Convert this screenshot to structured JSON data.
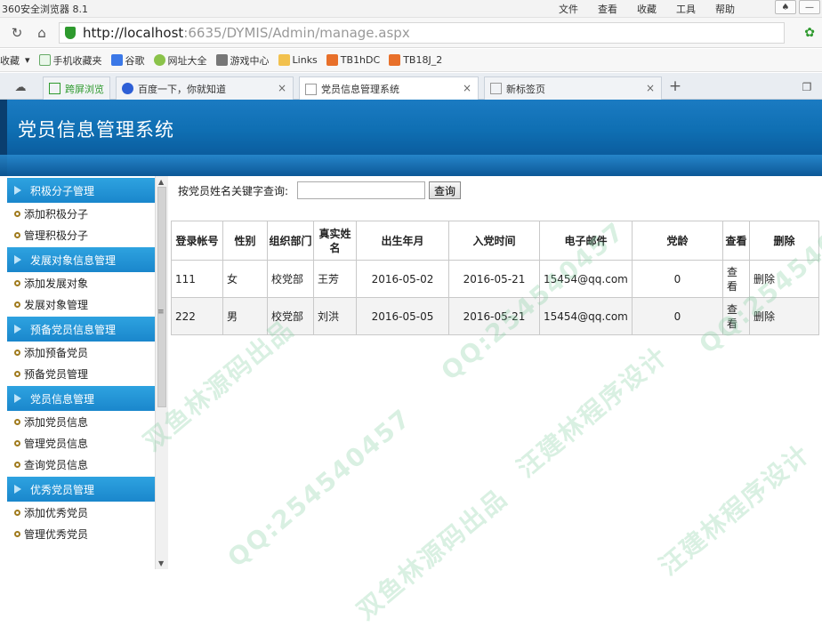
{
  "browser": {
    "title": "360安全浏览器 8.1",
    "menu": [
      "文件",
      "查看",
      "收藏",
      "工具",
      "帮助"
    ],
    "url_host": "http://localhost",
    "url_path": ":6635/DYMIS/Admin/manage.aspx",
    "favorites_label": "收藏",
    "favorites": [
      "手机收藏夹",
      "谷歌",
      "网址大全",
      "游戏中心",
      "Links",
      "TB1hDC",
      "TB18J_2"
    ],
    "tabs": [
      "跨屏浏览",
      "百度一下，你就知道",
      "党员信息管理系统",
      "新标签页"
    ]
  },
  "app": {
    "title": "党员信息管理系统"
  },
  "sidebar": {
    "sections": [
      {
        "title": "积极分子管理",
        "items": [
          "添加积极分子",
          "管理积极分子"
        ]
      },
      {
        "title": "发展对象信息管理",
        "items": [
          "添加发展对象",
          "发展对象管理"
        ]
      },
      {
        "title": "预备党员信息管理",
        "items": [
          "添加预备党员",
          "预备党员管理"
        ]
      },
      {
        "title": "党员信息管理",
        "items": [
          "添加党员信息",
          "管理党员信息",
          "查询党员信息"
        ]
      },
      {
        "title": "优秀党员管理",
        "items": [
          "添加优秀党员",
          "管理优秀党员"
        ]
      }
    ]
  },
  "search": {
    "label": "按党员姓名关键字查询:",
    "value": "",
    "button": "查询"
  },
  "table": {
    "headers": [
      "登录帐号",
      "性别",
      "组织部门",
      "真实姓名",
      "出生年月",
      "入党时间",
      "电子邮件",
      "党龄",
      "查看",
      "删除"
    ],
    "rows": [
      [
        "111",
        "女",
        "校党部",
        "王芳",
        "2016-05-02",
        "2016-05-21",
        "15454@qq.com",
        "0",
        "查看",
        "删除"
      ],
      [
        "222",
        "男",
        "校党部",
        "刘洪",
        "2016-05-05",
        "2016-05-21",
        "15454@qq.com",
        "0",
        "查看",
        "删除"
      ]
    ]
  },
  "watermark": [
    "QQ:254540457",
    "汪建林程序设计",
    "双鱼林源码出品"
  ]
}
